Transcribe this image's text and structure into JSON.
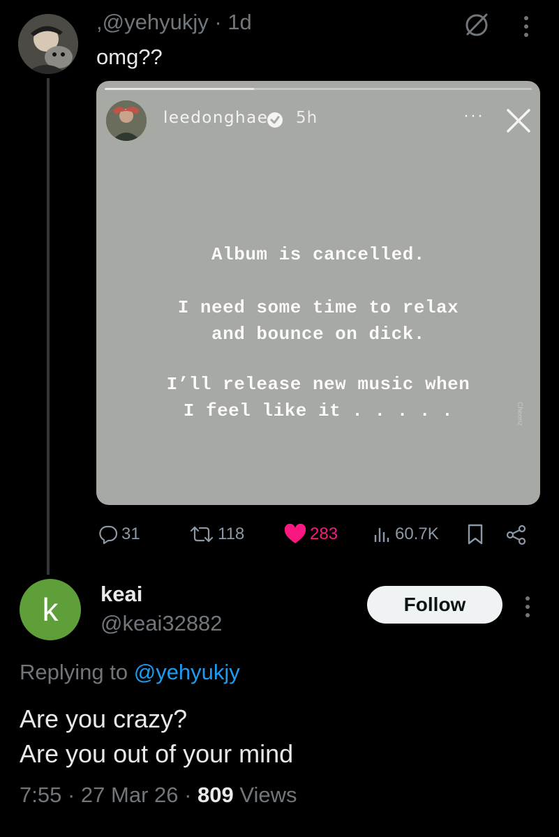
{
  "tweet": {
    "prefix": ",",
    "handle": "@yehyukjy",
    "separator": "·",
    "time": "1d",
    "text": "omg??",
    "embedded_story": {
      "username": "leedonghae",
      "time": "5h",
      "dots": "···",
      "lines": [
        "Album is cancelled.",
        "I need some time to relax",
        "and bounce on dick.",
        "I’ll release new music when",
        "I feel like it . . . . ."
      ],
      "watermark": "Cheonz"
    },
    "actions": {
      "replies": "31",
      "retweets": "118",
      "likes": "283",
      "views": "60.7K"
    }
  },
  "reply": {
    "avatar_letter": "k",
    "name": "keai",
    "handle": "@keai32882",
    "follow_label": "Follow",
    "replying_prefix": "Replying to ",
    "replying_mention": "@yehyukjy",
    "text_line1": "Are you crazy?",
    "text_line2": "Are you out of your mind",
    "time": "7:55",
    "date": "27 Mar 26",
    "views_count": "809",
    "views_label": "Views"
  },
  "colors": {
    "background": "#000000",
    "like": "#f91880",
    "mention": "#1d9bf0",
    "reply_avatar": "#5f9f3a",
    "secondary_text": "#71767b"
  },
  "icons": [
    "grok-icon",
    "more-icon",
    "verified-icon",
    "close-icon",
    "reply-icon",
    "retweet-icon",
    "heart-icon",
    "views-icon",
    "bookmark-icon",
    "share-icon"
  ]
}
